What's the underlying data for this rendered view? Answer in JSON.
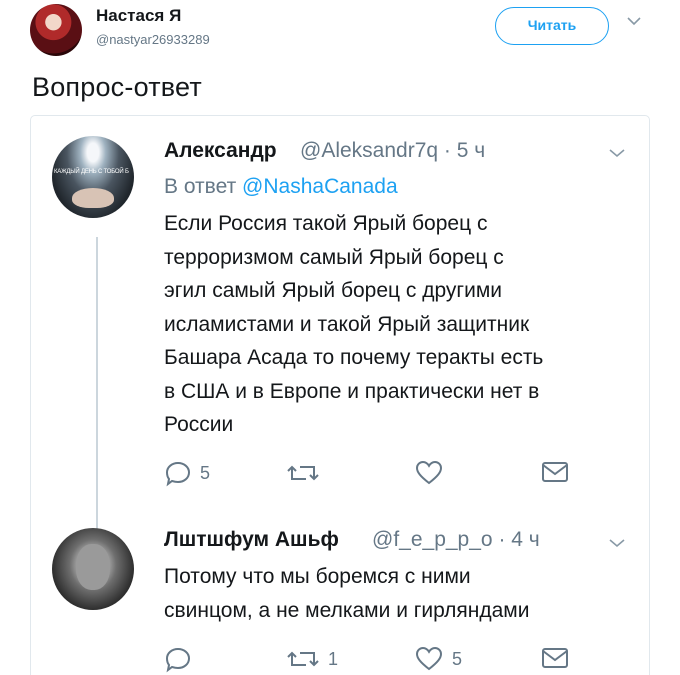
{
  "header": {
    "author_name": "Настася Я",
    "author_handle": "@nastyar26933289",
    "follow_label": "Читать",
    "text": "Вопрос-ответ"
  },
  "quoted": {
    "author_name": "Александр",
    "author_handle": "@Aleksandr7q",
    "time": "· 5 ч",
    "reply_prefix": "В ответ",
    "reply_to": "@NashaCanada",
    "avatar_caption": "КАЖДЫЙ ДЕНЬ С ТОБОЙ Б",
    "body_lines": [
      "Если Россия такой Ярый борец с",
      "терроризмом самый Ярый борец с",
      "эгил самый Ярый борец с другими",
      "исламистами и такой Ярый защитник",
      "Башара Асада то почему теракты есть",
      "в США и в Европе и практически нет в",
      "России"
    ],
    "actions": {
      "replies": "5",
      "retweets": "",
      "likes": ""
    }
  },
  "reply": {
    "author_name": "Лштшфум Ашьф",
    "author_handle": "@f_e_p_p_o",
    "time": "· 4 ч",
    "body_lines": [
      "Потому что мы боремся с ними",
      "свинцом, а не мелками и гирляндами"
    ],
    "actions": {
      "replies": "",
      "retweets": "1",
      "likes": "5"
    }
  },
  "colors": {
    "accent": "#1da1f2",
    "secondary_text": "#657786",
    "border": "#e1e8ed"
  },
  "icons": [
    "reply-icon",
    "retweet-icon",
    "like-icon",
    "direct-message-icon",
    "chevron-down-icon"
  ]
}
